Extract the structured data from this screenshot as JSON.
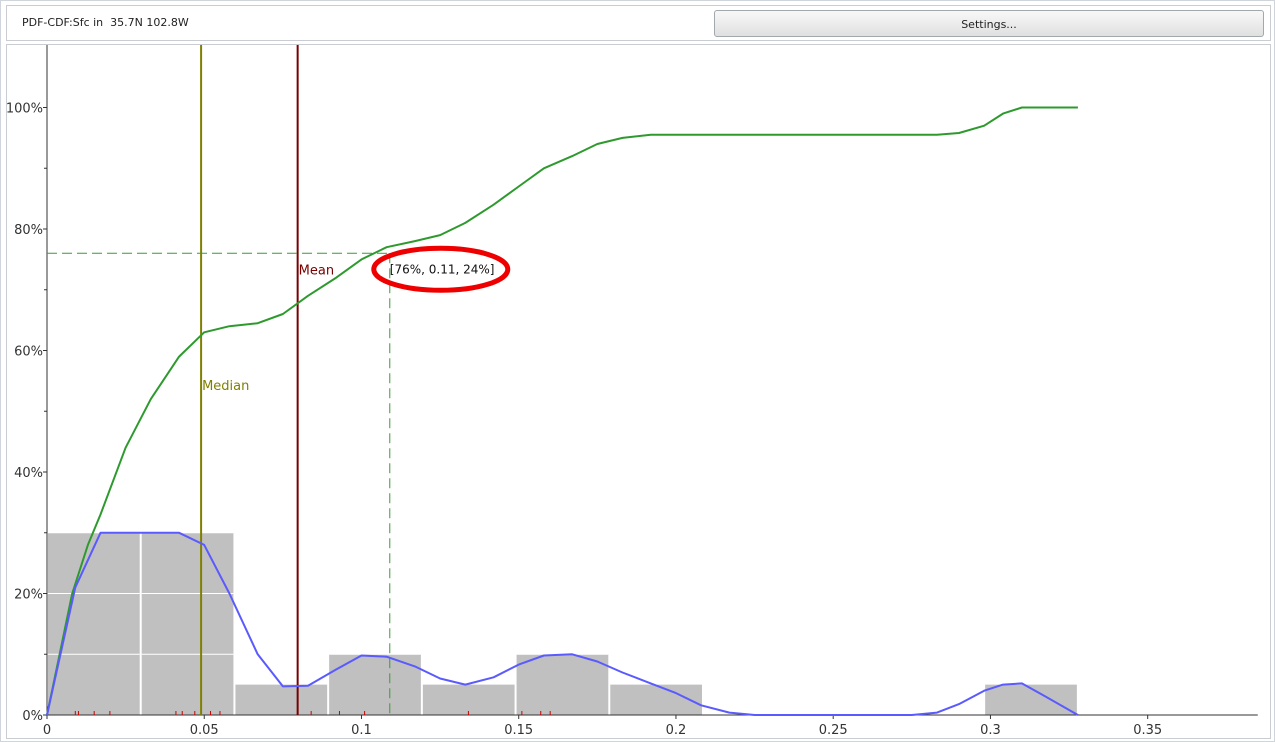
{
  "header": {
    "title": "PDF-CDF:Sfc in  35.7N 102.8W",
    "settings_label": "Settings..."
  },
  "chart_data": {
    "type": "bar",
    "title": "",
    "xlabel": "",
    "ylabel": "",
    "xlim": [
      0,
      0.385
    ],
    "ylim": [
      0,
      1.11
    ],
    "x_ticks": [
      {
        "value": 0,
        "label": "0"
      },
      {
        "value": 0.05,
        "label": "0.05"
      },
      {
        "value": 0.1,
        "label": "0.1"
      },
      {
        "value": 0.15,
        "label": "0.15"
      },
      {
        "value": 0.2,
        "label": "0.2"
      },
      {
        "value": 0.25,
        "label": "0.25"
      },
      {
        "value": 0.3,
        "label": "0.3"
      },
      {
        "value": 0.35,
        "label": "0.35"
      }
    ],
    "y_ticks": [
      {
        "value": 0,
        "label": "0%"
      },
      {
        "value": 0.2,
        "label": "20%"
      },
      {
        "value": 0.4,
        "label": "40%"
      },
      {
        "value": 0.6,
        "label": "60%"
      },
      {
        "value": 0.8,
        "label": "80%"
      },
      {
        "value": 1.0,
        "label": "100%"
      }
    ],
    "y_minor_ticks": [
      0.1,
      0.3,
      0.5,
      0.7,
      0.9
    ],
    "histogram": {
      "color": "#c0c0c0",
      "bins": [
        {
          "x0": 0.0,
          "x1": 0.0298,
          "value": 0.3
        },
        {
          "x0": 0.0298,
          "x1": 0.0596,
          "value": 0.3
        },
        {
          "x0": 0.0596,
          "x1": 0.0894,
          "value": 0.05
        },
        {
          "x0": 0.0894,
          "x1": 0.1192,
          "value": 0.1
        },
        {
          "x0": 0.1192,
          "x1": 0.149,
          "value": 0.05
        },
        {
          "x0": 0.149,
          "x1": 0.1788,
          "value": 0.1
        },
        {
          "x0": 0.1788,
          "x1": 0.2086,
          "value": 0.05
        },
        {
          "x0": 0.2086,
          "x1": 0.2384,
          "value": 0
        },
        {
          "x0": 0.2384,
          "x1": 0.2682,
          "value": 0
        },
        {
          "x0": 0.2682,
          "x1": 0.298,
          "value": 0
        },
        {
          "x0": 0.298,
          "x1": 0.3278,
          "value": 0.05
        }
      ]
    },
    "series": [
      {
        "color": "#2e9a2e",
        "x": [
          0,
          0.004,
          0.008,
          0.013,
          0.017,
          0.025,
          0.033,
          0.042,
          0.05,
          0.058,
          0.067,
          0.075,
          0.083,
          0.092,
          0.1,
          0.108,
          0.117,
          0.125,
          0.133,
          0.142,
          0.15,
          0.158,
          0.167,
          0.175,
          0.183,
          0.192,
          0.2,
          0.208,
          0.217,
          0.225,
          0.233,
          0.242,
          0.25,
          0.258,
          0.267,
          0.275,
          0.283,
          0.29,
          0.298,
          0.304,
          0.31,
          0.3278
        ],
        "y": [
          0,
          0.1,
          0.2,
          0.28,
          0.33,
          0.44,
          0.52,
          0.59,
          0.63,
          0.64,
          0.645,
          0.66,
          0.69,
          0.72,
          0.75,
          0.77,
          0.78,
          0.79,
          0.81,
          0.84,
          0.87,
          0.9,
          0.92,
          0.94,
          0.95,
          0.955,
          0.955,
          0.955,
          0.955,
          0.955,
          0.955,
          0.955,
          0.955,
          0.955,
          0.955,
          0.955,
          0.955,
          0.958,
          0.97,
          0.99,
          1.0,
          1.0
        ]
      },
      {
        "color": "#5a5aff",
        "x": [
          0,
          0.009,
          0.017,
          0.025,
          0.033,
          0.042,
          0.05,
          0.058,
          0.067,
          0.075,
          0.083,
          0.092,
          0.1,
          0.108,
          0.117,
          0.125,
          0.133,
          0.142,
          0.15,
          0.158,
          0.167,
          0.175,
          0.183,
          0.192,
          0.2,
          0.208,
          0.217,
          0.225,
          0.25,
          0.275,
          0.283,
          0.29,
          0.298,
          0.304,
          0.31,
          0.317,
          0.3278
        ],
        "y": [
          0,
          0.21,
          0.3,
          0.3,
          0.3,
          0.3,
          0.28,
          0.2,
          0.1,
          0.047,
          0.048,
          0.075,
          0.098,
          0.096,
          0.08,
          0.06,
          0.05,
          0.062,
          0.083,
          0.098,
          0.1,
          0.088,
          0.07,
          0.052,
          0.036,
          0.016,
          0.004,
          0,
          0,
          0,
          0.004,
          0.018,
          0.04,
          0.05,
          0.052,
          0.032,
          0
        ]
      }
    ],
    "vertical_lines": [
      {
        "x": 0.049,
        "label": "Median",
        "color": "#808000",
        "label_y": 0.535
      },
      {
        "x": 0.0797,
        "label": "Mean",
        "color": "#7a0000",
        "label_y": 0.725
      }
    ],
    "crosshair": {
      "x": 0.109,
      "y": 0.76,
      "color": "#3a9a3a",
      "label": "[76%, 0.11, 24%]"
    },
    "highlight_color": "#ee0000",
    "rug_color": "#cc0000",
    "rug": [
      0.009,
      0.01,
      0.015,
      0.02,
      0.041,
      0.043,
      0.047,
      0.052,
      0.055,
      0.084,
      0.093,
      0.101,
      0.134,
      0.151,
      0.157,
      0.16
    ]
  }
}
